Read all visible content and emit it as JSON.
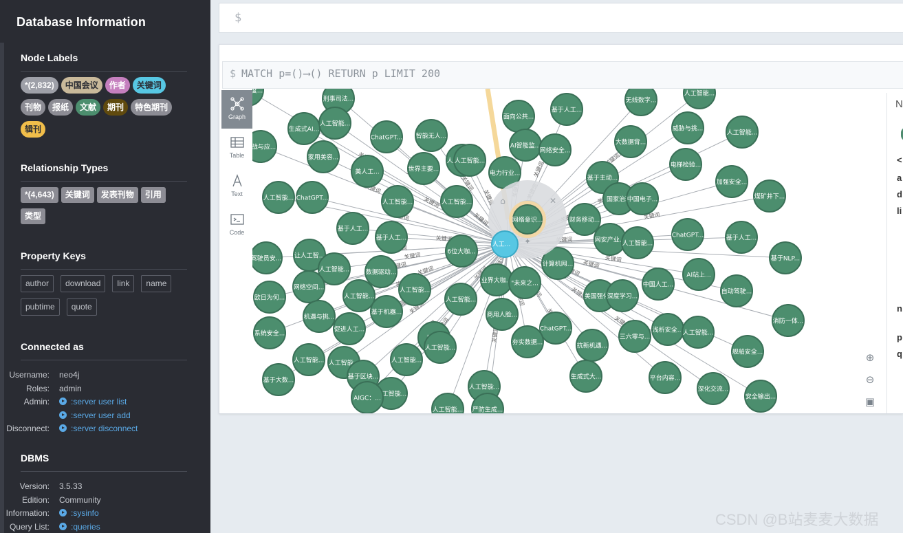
{
  "sidebar": {
    "title": "Database Information",
    "node_labels": {
      "heading": "Node Labels",
      "items": [
        {
          "label": "*(2,832)",
          "color": "#9ea0a8"
        },
        {
          "label": "中国会议",
          "color": "#c9b99a"
        },
        {
          "label": "作者",
          "color": "#c57fbe"
        },
        {
          "label": "关键词",
          "color": "#57c7e3"
        },
        {
          "label": "刊物",
          "color": "#8c8c94"
        },
        {
          "label": "报纸",
          "color": "#8c8c94"
        },
        {
          "label": "文献",
          "color": "#4c8e6e"
        },
        {
          "label": "期刊",
          "color": "#604a0e"
        },
        {
          "label": "特色期刊",
          "color": "#8c8c94"
        },
        {
          "label": "辑刊",
          "color": "#f1be4a"
        }
      ]
    },
    "relationship_types": {
      "heading": "Relationship Types",
      "items": [
        "*(4,643)",
        "关键词",
        "发表刊物",
        "引用",
        "类型"
      ]
    },
    "property_keys": {
      "heading": "Property Keys",
      "items": [
        "author",
        "download",
        "link",
        "name",
        "pubtime",
        "quote"
      ]
    },
    "connected_as": {
      "heading": "Connected as",
      "rows": [
        {
          "key": "Username:",
          "value": "neo4j",
          "link": false
        },
        {
          "key": "Roles:",
          "value": "admin",
          "link": false
        },
        {
          "key": "Admin:",
          "value": ":server user list",
          "link": true
        },
        {
          "key": "",
          "value": ":server user add",
          "link": true
        },
        {
          "key": "Disconnect:",
          "value": ":server disconnect",
          "link": true
        }
      ]
    },
    "dbms": {
      "heading": "DBMS",
      "rows": [
        {
          "key": "Version:",
          "value": "3.5.33",
          "link": false
        },
        {
          "key": "Edition:",
          "value": "Community",
          "link": false
        },
        {
          "key": "Information:",
          "value": ":sysinfo",
          "link": true
        },
        {
          "key": "Query List:",
          "value": ":queries",
          "link": true
        }
      ]
    }
  },
  "editor": {
    "prompt": "$"
  },
  "frame": {
    "query_prompt": "$",
    "query": "MATCH p=()⟶() RETURN p LIMIT 200",
    "tabs": [
      {
        "label": "Graph",
        "icon": "graph-icon",
        "active": true
      },
      {
        "label": "Table",
        "icon": "table-icon",
        "active": false
      },
      {
        "label": "Text",
        "icon": "text-icon",
        "active": false
      },
      {
        "label": "Code",
        "icon": "code-icon",
        "active": false
      }
    ],
    "side_panel_chars": [
      "N",
      "<",
      "a",
      "d",
      "li",
      "n",
      "p",
      "q"
    ],
    "zoom": [
      "zoom-in-icon",
      "zoom-out-icon",
      "fit-icon"
    ]
  },
  "graph": {
    "node_color": "#4c8e6e",
    "edge_label": "关键词",
    "nodes": [
      "基于深度...",
      "刑事司法...",
      "人工智能...",
      "面向公共...",
      "基于人工...",
      "无线数字...",
      "人工智能...",
      "生成式AI...",
      "智能无人...",
      "ChatGPT...",
      "AI智能监...",
      "人工智能...",
      "网络安全...",
      "大数据背...",
      "威胁与挑...",
      "人工智能...",
      "挑战与应...",
      "家用美容...",
      "美人工...",
      "世界主要...",
      "人工智能...",
      "电力行业...",
      "电梯检验...",
      "基于主动...",
      "加强安全...",
      "人工智能...",
      "ChatGPT...",
      "人工智能...",
      "人工智能...",
      "网络意识...",
      "国家治理",
      "中国电子...",
      "煤矿井下...",
      "基于人工...",
      "基于人工...",
      "财务移动...",
      "ChatGPT...",
      "驾驶员安...",
      "让人工智...",
      "6位大咖...",
      "网安产业...",
      "人工智能...",
      "基于人工...",
      "基于NLP...",
      "人工智能...",
      "数据驱动...",
      "网络空间...",
      "计算机网...",
      "AI站上...",
      "欧日为何...",
      "人工智能...",
      "人工智能...",
      "业界大咖...",
      "\"未来之...",
      "中国人工...",
      "美国强化...",
      "深度学习...",
      "自动驾驶...",
      "机遇与挑...",
      "基于机器...",
      "人工智能...",
      "商用人脸...",
      "消防一体...",
      "系统安全...",
      "促进人工...",
      "人工...",
      "ChatGPT...",
      "人工智能...",
      "三六零与...",
      "浅析安全...",
      "人工智能...",
      "舰船安全...",
      "夯实数据...",
      "抗新机遇...",
      "人工智能...",
      "人工智能...",
      "人工智能...",
      "基于区块...",
      "生成式大...",
      "平台内容...",
      "深化交流...",
      "基于大数...",
      "人工智能...",
      "人工智能...",
      "AIGC：...",
      "人工智能...",
      "严防生成...",
      "安全输出..."
    ],
    "center_label": "人工..."
  },
  "watermark": "CSDN @B站麦麦大数据"
}
